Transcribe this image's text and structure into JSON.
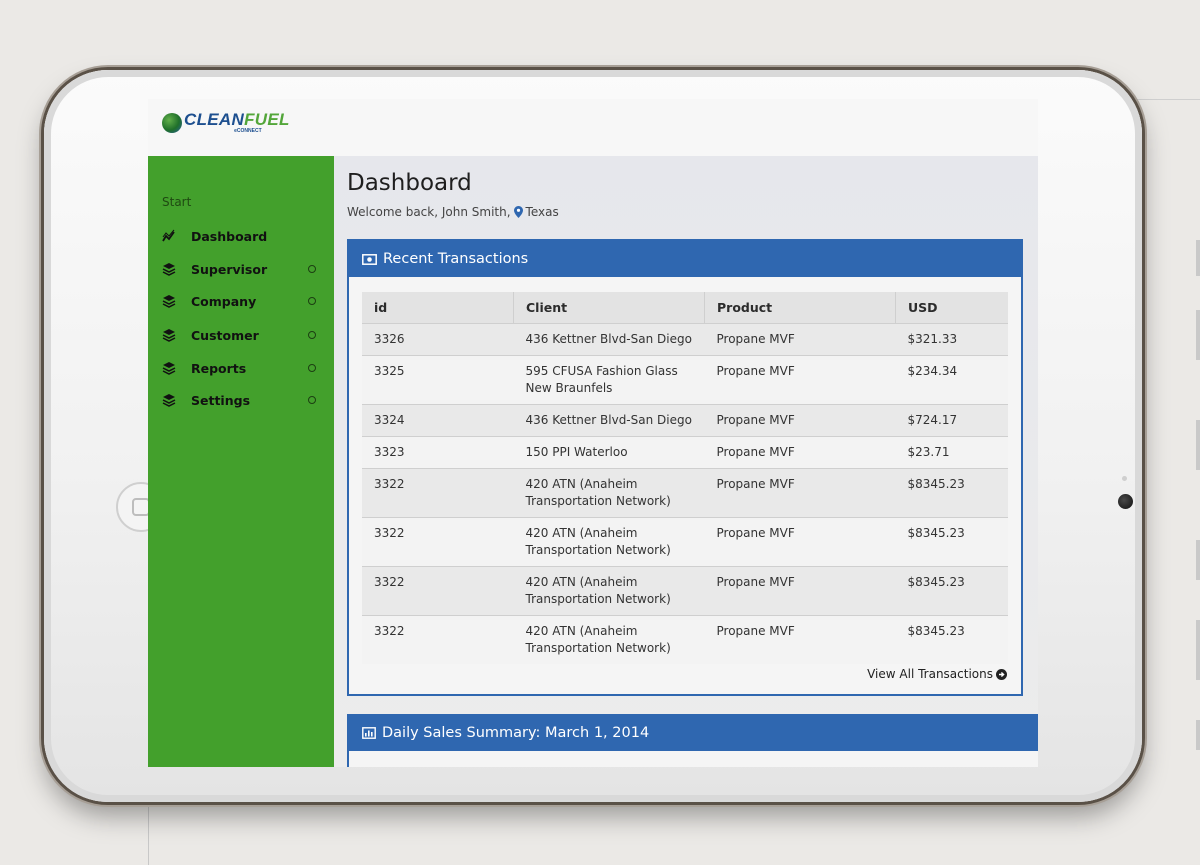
{
  "app": {
    "logo_main_left": "CLEAN",
    "logo_main_right": "FUEL",
    "logo_sub": "eCONNECT"
  },
  "sidebar": {
    "start_label": "Start",
    "items": [
      {
        "label": "Dashboard",
        "icon": "chart-line-icon",
        "has_dot": false
      },
      {
        "label": "Supervisor",
        "icon": "layers-icon",
        "has_dot": true
      },
      {
        "label": "Company",
        "icon": "layers-icon",
        "has_dot": true
      },
      {
        "label": "Customer",
        "icon": "layers-icon",
        "has_dot": true
      },
      {
        "label": "Reports",
        "icon": "layers-icon",
        "has_dot": true
      },
      {
        "label": "Settings",
        "icon": "layers-icon",
        "has_dot": true
      }
    ]
  },
  "header": {
    "title": "Dashboard",
    "welcome_prefix": "Welcome back, John Smith,",
    "location": "Texas"
  },
  "transactions": {
    "title": "Recent Transactions",
    "columns": [
      "id",
      "Client",
      "Product",
      "USD"
    ],
    "rows": [
      {
        "id": "3326",
        "client_1": "436 Kettner Blvd-San Diego",
        "client_2": "",
        "product": "Propane MVF",
        "usd": "$321.33"
      },
      {
        "id": "3325",
        "client_1": "595 CFUSA Fashion Glass",
        "client_2": "New Braunfels",
        "product": "Propane MVF",
        "usd": "$234.34"
      },
      {
        "id": "3324",
        "client_1": "436 Kettner Blvd-San Diego",
        "client_2": "",
        "product": "Propane MVF",
        "usd": "$724.17"
      },
      {
        "id": "3323",
        "client_1": "150 PPI Waterloo",
        "client_2": "",
        "product": "Propane MVF",
        "usd": "$23.71"
      },
      {
        "id": "3322",
        "client_1": "420 ATN (Anaheim",
        "client_2": "Transportation Network)",
        "product": "Propane MVF",
        "usd": "$8345.23"
      },
      {
        "id": "3322",
        "client_1": "420 ATN (Anaheim",
        "client_2": "Transportation Network)",
        "product": "Propane MVF",
        "usd": "$8345.23"
      },
      {
        "id": "3322",
        "client_1": "420 ATN (Anaheim",
        "client_2": "Transportation Network)",
        "product": "Propane MVF",
        "usd": "$8345.23"
      },
      {
        "id": "3322",
        "client_1": "420 ATN (Anaheim",
        "client_2": "Transportation Network)",
        "product": "Propane MVF",
        "usd": "$8345.23"
      }
    ],
    "view_all_label": "View All Transactions"
  },
  "daily_sales": {
    "title": "Daily Sales Summary: March 1, 2014"
  },
  "colors": {
    "sidebar_green": "#43a02c",
    "panel_blue": "#2f67b0",
    "logo_blue": "#1d4f8f",
    "logo_green": "#53a63a"
  }
}
